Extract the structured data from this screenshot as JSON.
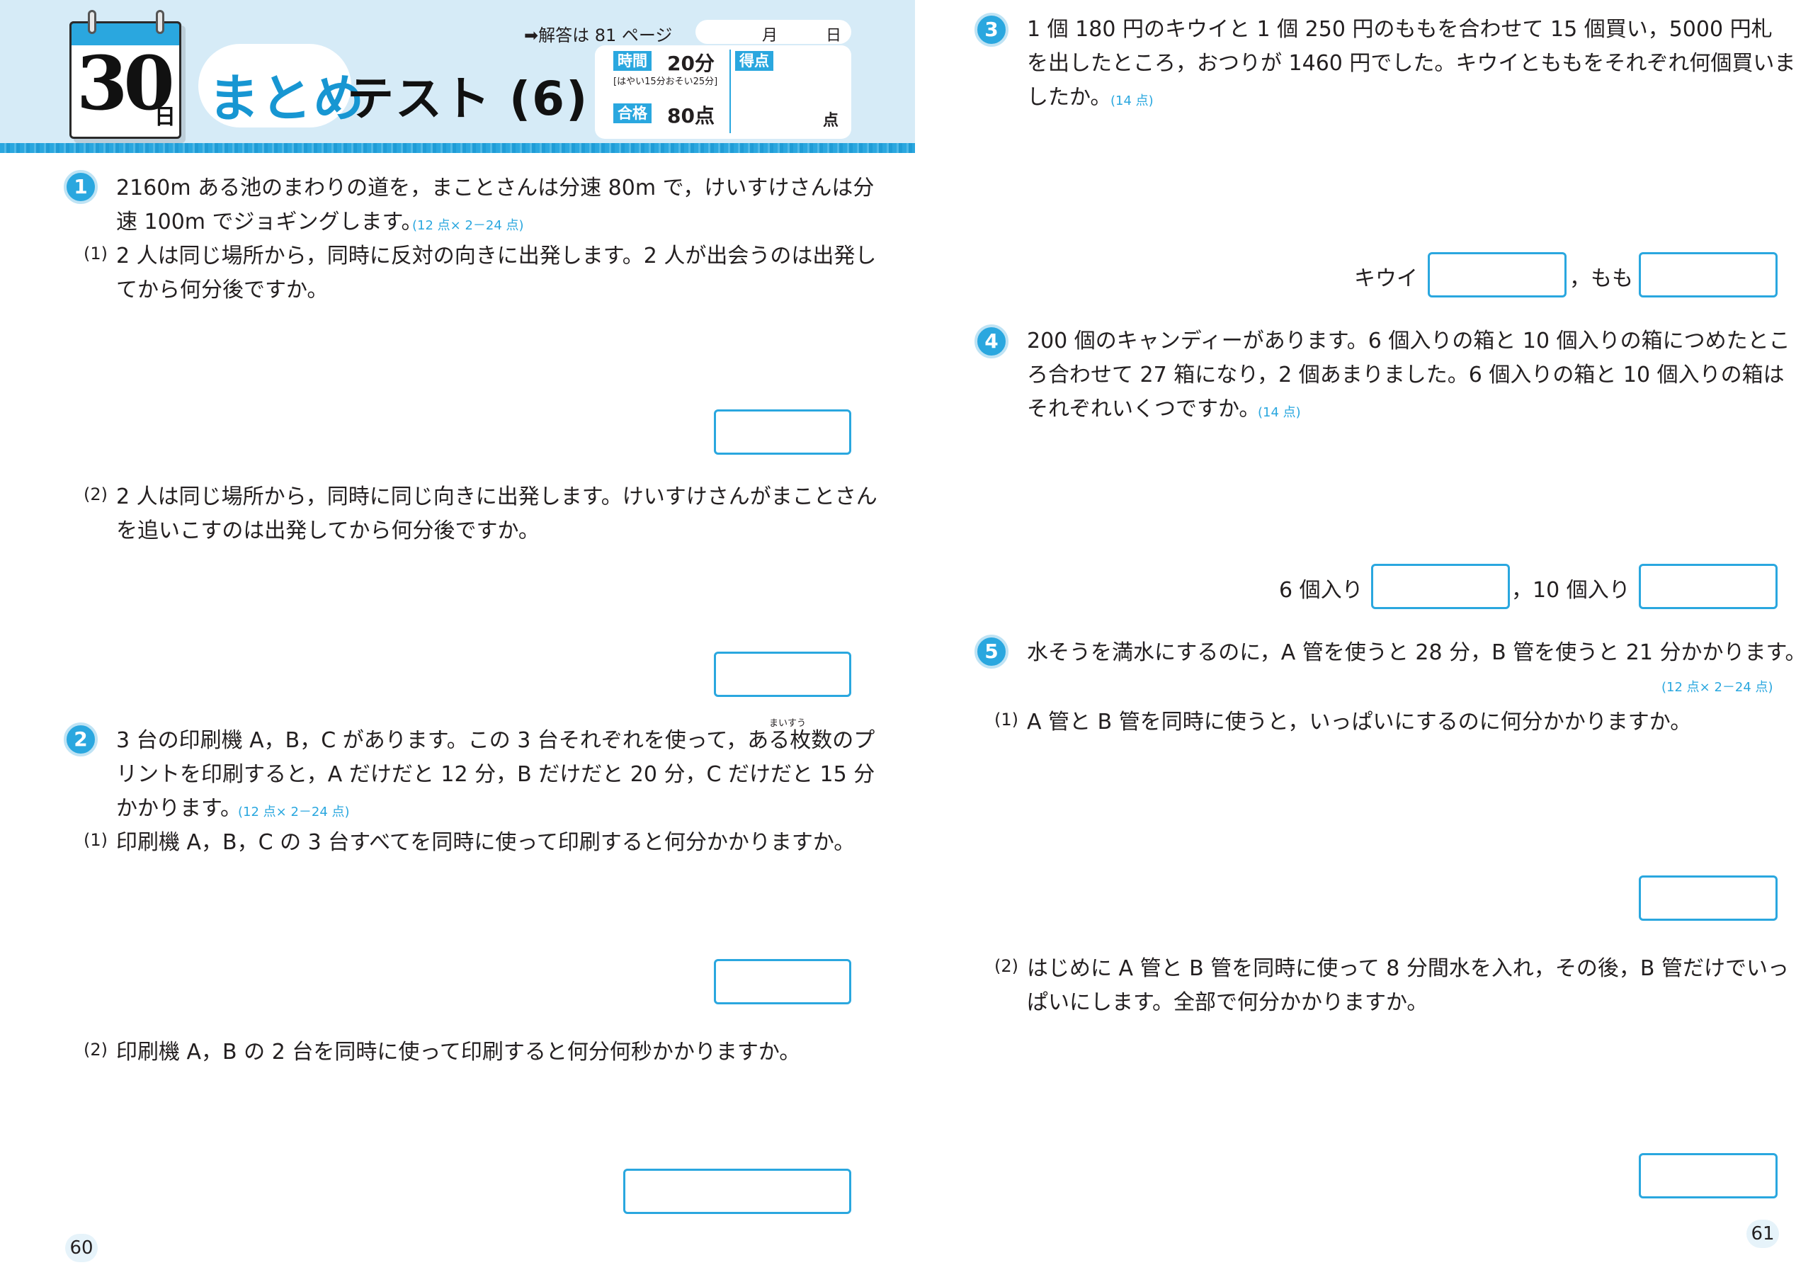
{
  "header": {
    "day_number": "30",
    "day_unit": "日",
    "title_accent": "まとめ",
    "title_main": "テスト (6)",
    "answer_ref": "➡解答は 81 ページ",
    "date_month": "月",
    "date_day": "日",
    "time_label": "時間",
    "time_value": "20分",
    "time_note": "[はやい15分おそい25分]",
    "pass_label": "合格",
    "pass_value": "80点",
    "score_label": "得点",
    "score_unit": "点"
  },
  "questions": {
    "q1": {
      "num": "1",
      "line1": "2160m ある池のまわりの道を，まことさんは分速 80m で，けいすけさんは分",
      "line2": "速 100m でジョギングします。",
      "points": "(12 点× 2－24 点)",
      "sub1": {
        "num": "(1)",
        "line1": "2 人は同じ場所から，同時に反対の向きに出発します。2 人が出会うのは出発し",
        "line2": "てから何分後ですか。"
      },
      "sub2": {
        "num": "(2)",
        "line1": "2 人は同じ場所から，同時に同じ向きに出発します。けいすけさんがまことさん",
        "line2": "を追いこすのは出発してから何分後ですか。"
      }
    },
    "q2": {
      "num": "2",
      "ruby": "まいすう",
      "line1": "3 台の印刷機 A，B，C があります。この 3 台それぞれを使って，ある枚数のプ",
      "line2": "リントを印刷すると，A だけだと 12 分，B だけだと 20 分，C だけだと 15 分",
      "line3": "かかります。",
      "points": "(12 点× 2－24 点)",
      "sub1": {
        "num": "(1)",
        "line1": "印刷機 A，B，C の 3 台すべてを同時に使って印刷すると何分かかりますか。"
      },
      "sub2": {
        "num": "(2)",
        "line1": "印刷機 A，B の 2 台を同時に使って印刷すると何分何秒かかりますか。"
      }
    },
    "q3": {
      "num": "3",
      "line1": "1 個 180 円のキウイと 1 個 250 円のももを合わせて 15 個買い，5000 円札",
      "line2": "を出したところ，おつりが 1460 円でした。キウイとももをそれぞれ何個買いま",
      "line3": "したか。",
      "points": "(14 点)",
      "label_a": "キウイ",
      "label_b": "，もも"
    },
    "q4": {
      "num": "4",
      "line1": "200 個のキャンディーがあります。6 個入りの箱と 10 個入りの箱につめたとこ",
      "line2": "ろ合わせて 27 箱になり，2 個あまりました。6 個入りの箱と 10 個入りの箱は",
      "line3": "それぞれいくつですか。",
      "points": "(14 点)",
      "label_a": "6 個入り",
      "label_b": "，10 個入り"
    },
    "q5": {
      "num": "5",
      "line1": "水そうを満水にするのに，A 管を使うと 28 分，B 管を使うと 21 分かかります。",
      "points": "(12 点× 2－24 点)",
      "sub1": {
        "num": "(1)",
        "line1": "A 管と B 管を同時に使うと，いっぱいにするのに何分かかりますか。"
      },
      "sub2": {
        "num": "(2)",
        "line1": "はじめに A 管と B 管を同時に使って 8 分間水を入れ，その後，B 管だけでいっ",
        "line2": "ぱいにします。全部で何分かかりますか。"
      }
    }
  },
  "pages": {
    "left": "60",
    "right": "61"
  },
  "colors": {
    "accent": "#2aa7df",
    "band": "#d6ebf7",
    "text": "#231f20"
  }
}
